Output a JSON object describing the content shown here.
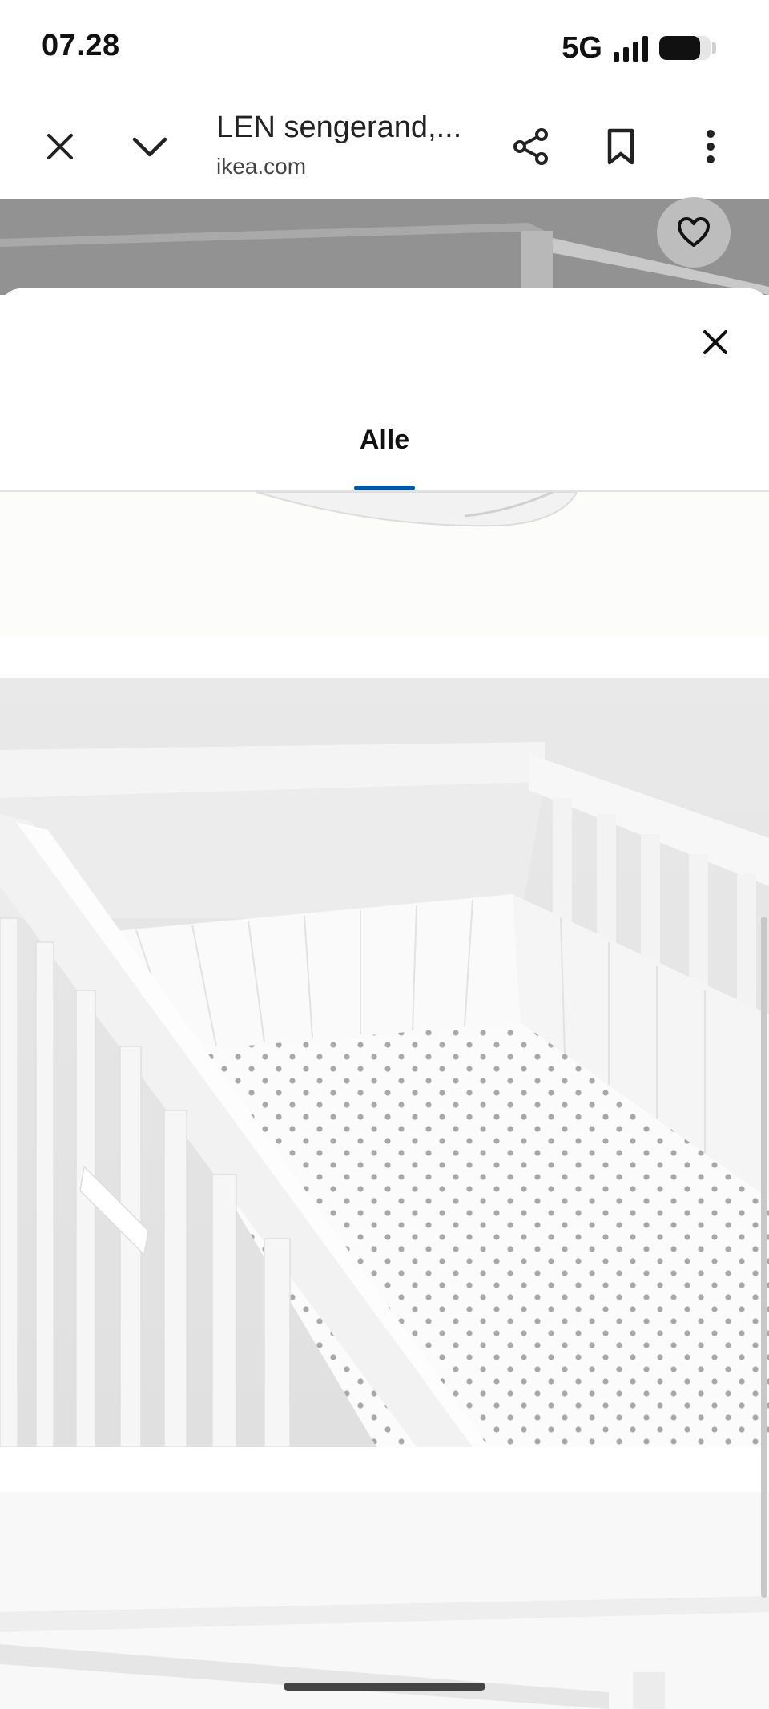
{
  "status_bar": {
    "time": "07.28",
    "network": "5G",
    "signal_bars": 4,
    "battery_level_pct": 80
  },
  "toolbar": {
    "title": "LEN sengerand,...",
    "url": "ikea.com",
    "icons": [
      "close-icon",
      "chevron-down-icon",
      "share-icon",
      "bookmark-icon",
      "more-vert-icon"
    ]
  },
  "background_page": {
    "favorite_icon": "heart-icon"
  },
  "sheet": {
    "close_icon": "close-icon",
    "tabs": [
      {
        "label": "Alle",
        "active": true
      }
    ],
    "accent_color": "#0058a3",
    "images": [
      "product-image-partial",
      "crib-bumper-image",
      "product-image-next"
    ]
  }
}
